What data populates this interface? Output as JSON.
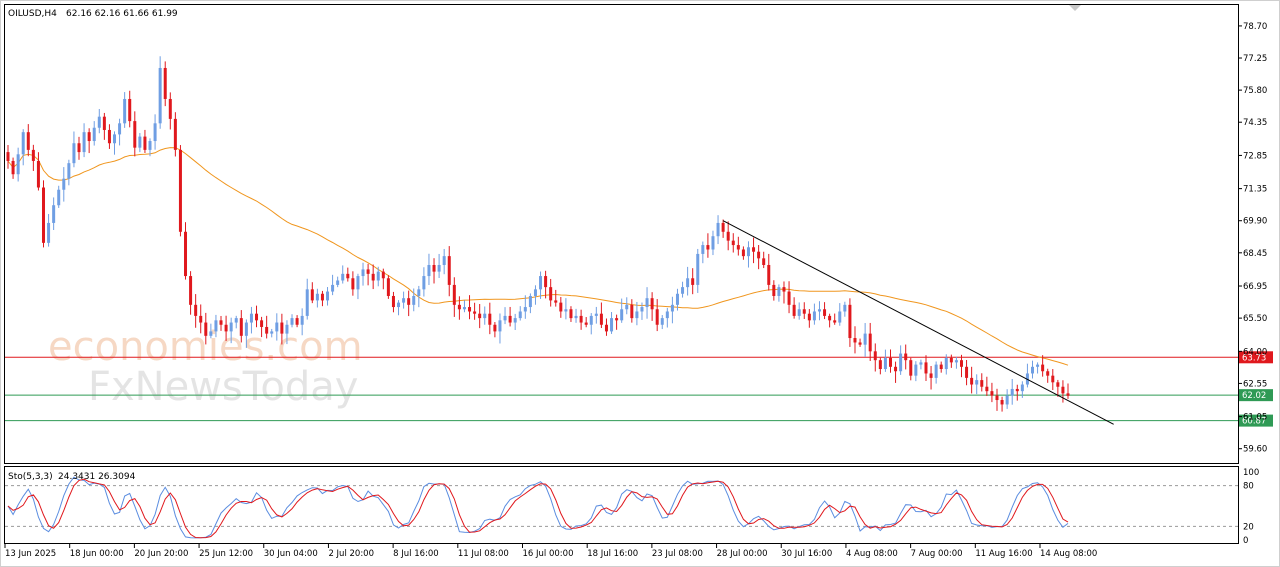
{
  "header": {
    "symbol_label": "OILUSD,H4",
    "ohlc_label": "62.16 62.16 61.66 61.99"
  },
  "watermark": {
    "line1": "economies.com",
    "line2": "FxNewsToday"
  },
  "indicator": {
    "label": "Sto(5,3,3)",
    "values_label": "24.3431 26.3094",
    "levels": [
      "100",
      "80",
      "20",
      "0"
    ]
  },
  "colors": {
    "bull": "#6f9ee3",
    "bear": "#e0181d",
    "ma": "#f0961e",
    "resistance": "#e0181d",
    "support": "#2f9a55",
    "trendline": "#000000",
    "stoch_main": "#5b8de0",
    "stoch_signal": "#e0181d"
  },
  "chart_data": {
    "type": "candlestick",
    "instrument": "OILUSD",
    "timeframe": "H4",
    "ylim": [
      59.0,
      79.6
    ],
    "y_ticks": [
      "78.70",
      "77.25",
      "75.80",
      "74.35",
      "72.85",
      "71.35",
      "69.90",
      "68.45",
      "66.95",
      "65.50",
      "64.00",
      "62.55",
      "61.05",
      "59.60"
    ],
    "x_ticks": [
      "13 Jun 2025",
      "18 Jun 00:00",
      "20 Jun 20:00",
      "25 Jun 12:00",
      "30 Jun 04:00",
      "2 Jul 20:00",
      "8 Jul 16:00",
      "11 Jul 08:00",
      "16 Jul 00:00",
      "18 Jul 16:00",
      "23 Jul 08:00",
      "28 Jul 00:00",
      "30 Jul 16:00",
      "4 Aug 08:00",
      "7 Aug 00:00",
      "11 Aug 16:00",
      "14 Aug 08:00"
    ],
    "closes": [
      72.6,
      72.0,
      72.9,
      73.9,
      73.1,
      72.6,
      71.4,
      68.9,
      69.8,
      70.6,
      71.3,
      71.8,
      72.5,
      73.4,
      73.0,
      73.9,
      73.5,
      74.1,
      74.6,
      74.0,
      73.4,
      73.8,
      74.3,
      75.4,
      74.4,
      73.2,
      73.7,
      73.1,
      73.5,
      74.3,
      76.8,
      75.4,
      74.5,
      73.1,
      69.4,
      67.4,
      66.1,
      65.6,
      65.3,
      64.7,
      64.9,
      65.4,
      65.2,
      64.9,
      65.3,
      65.5,
      64.7,
      65.3,
      65.7,
      65.4,
      65.1,
      64.8,
      64.9,
      65.3,
      64.8,
      65.2,
      65.5,
      65.2,
      65.6,
      66.8,
      66.3,
      66.6,
      66.3,
      66.7,
      67.0,
      67.2,
      67.5,
      67.3,
      66.8,
      67.4,
      67.7,
      67.5,
      67.2,
      67.6,
      67.3,
      66.5,
      66.0,
      66.2,
      66.4,
      66.1,
      66.5,
      66.8,
      67.4,
      67.9,
      67.6,
      67.9,
      68.3,
      67.0,
      66.1,
      65.9,
      66.0,
      65.8,
      65.7,
      65.5,
      65.7,
      65.2,
      64.9,
      65.4,
      65.6,
      65.3,
      65.5,
      65.8,
      66.0,
      66.5,
      66.8,
      67.4,
      66.9,
      66.3,
      66.2,
      65.8,
      65.9,
      65.5,
      65.6,
      65.3,
      65.2,
      65.6,
      65.7,
      65.2,
      64.9,
      65.5,
      65.4,
      65.9,
      66.1,
      65.5,
      65.8,
      66.0,
      66.4,
      65.9,
      65.2,
      65.5,
      65.8,
      66.1,
      66.6,
      66.9,
      67.3,
      67.0,
      68.4,
      68.8,
      68.6,
      69.2,
      69.8,
      69.4,
      69.0,
      68.8,
      68.6,
      68.3,
      68.7,
      68.5,
      68.2,
      67.9,
      67.0,
      66.5,
      66.9,
      66.7,
      66.1,
      65.6,
      65.9,
      65.7,
      65.4,
      65.8,
      65.9,
      65.6,
      65.4,
      65.3,
      65.8,
      66.1,
      64.6,
      64.4,
      64.3,
      64.8,
      64.0,
      63.6,
      63.2,
      63.7,
      63.3,
      63.1,
      63.9,
      63.6,
      62.9,
      63.4,
      63.5,
      63.0,
      62.8,
      63.4,
      63.2,
      63.7,
      63.5,
      63.6,
      63.3,
      62.8,
      62.5,
      62.7,
      62.4,
      62.2,
      62.0,
      61.8,
      61.6,
      62.0,
      62.3,
      62.2,
      62.5,
      63.0,
      63.3,
      63.4,
      63.1,
      62.9,
      62.6,
      62.4,
      62.1,
      61.99
    ],
    "ma_period": 50,
    "levels": [
      {
        "label": "63.73",
        "value": 63.73
      },
      {
        "label": "62.02",
        "value": 62.02
      },
      {
        "label": "60.87",
        "value": 60.87
      }
    ],
    "trendline": {
      "from_index": 141,
      "from_price": 69.9,
      "to_index": 218,
      "to_price": 60.7
    },
    "stochastic": {
      "k": 24.3431,
      "d": 26.3094,
      "ylim": [
        0,
        100
      ],
      "levels": [
        80,
        20
      ]
    }
  }
}
